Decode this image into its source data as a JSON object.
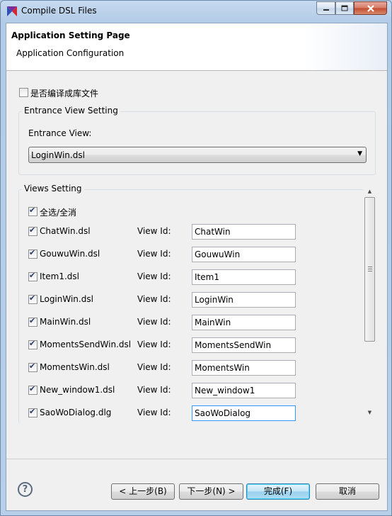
{
  "window": {
    "title": "Compile DSL Files"
  },
  "header": {
    "title": "Application Setting Page",
    "subtitle": "Application Configuration"
  },
  "compile_lib_checkbox": {
    "label": "是否编译成库文件",
    "checked": false
  },
  "entrance_group": {
    "title": "Entrance View Setting",
    "label": "Entrance View:",
    "selected": "LoginWin.dsl"
  },
  "views_group": {
    "title": "Views Setting",
    "select_all": {
      "label": "全选/全消",
      "checked": true
    },
    "view_id_label": "View Id:",
    "rows": [
      {
        "file": "ChatWin.dsl",
        "id": "ChatWin",
        "checked": true
      },
      {
        "file": "GouwuWin.dsl",
        "id": "GouwuWin",
        "checked": true
      },
      {
        "file": "Item1.dsl",
        "id": "Item1",
        "checked": true
      },
      {
        "file": "LoginWin.dsl",
        "id": "LoginWin",
        "checked": true
      },
      {
        "file": "MainWin.dsl",
        "id": "MainWin",
        "checked": true
      },
      {
        "file": "MomentsSendWin.dsl",
        "id": "MomentsSendWin",
        "checked": true
      },
      {
        "file": "MomentsWin.dsl",
        "id": "MomentsWin",
        "checked": true
      },
      {
        "file": "New_window1.dsl",
        "id": "New_window1",
        "checked": true
      },
      {
        "file": "SaoWoDialog.dlg",
        "id": "SaoWoDialog",
        "checked": true
      }
    ]
  },
  "footer": {
    "back_label": "< 上一步(B)",
    "next_label": "下一步(N) >",
    "finish_label": "完成(F)",
    "cancel_label": "取消"
  }
}
